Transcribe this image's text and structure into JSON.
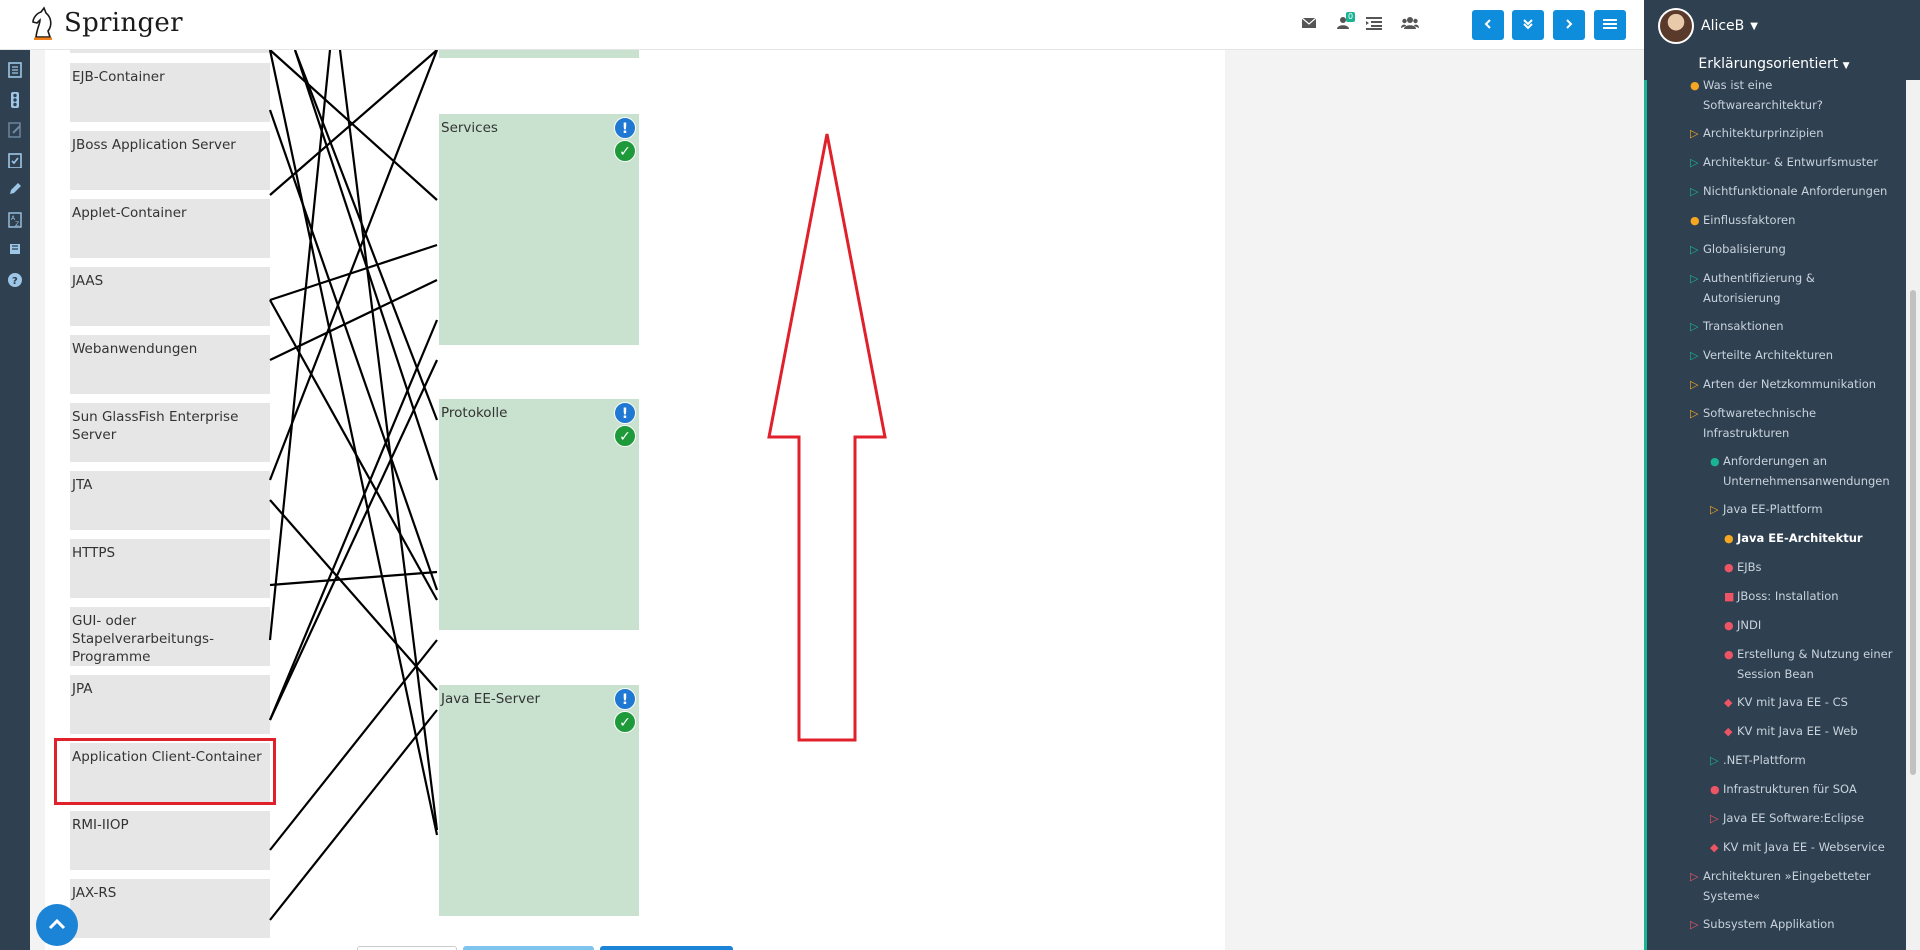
{
  "app": {
    "brand": "Springer",
    "username": "AliceB",
    "mode_label": "Erklärungsorientiert",
    "notification_count": "0"
  },
  "icons": {
    "top": [
      "envelope-icon",
      "users-notification-icon",
      "indent-list-icon",
      "group-icon"
    ],
    "nav": [
      "chevron-left-icon",
      "double-chevron-down-icon",
      "chevron-right-icon",
      "hamburger-menu-icon"
    ],
    "left": [
      "document-icon",
      "traffic-light-icon",
      "edit-document-icon",
      "clipboard-check-icon",
      "pencil-icon",
      "a-z-icon",
      "book-icon",
      "question-icon"
    ]
  },
  "colors": {
    "accent_blue": "#0d8ddb",
    "sidebar_dark": "#2f4050",
    "teal": "#1ab394",
    "target_green": "#c9e2cf",
    "highlight_red": "#e0202a"
  },
  "exercise": {
    "source_items": [
      "EJB-Container",
      "JBoss Application Server",
      "Applet-Container",
      "JAAS",
      "Webanwendungen",
      "Sun GlassFish Enterprise Server",
      "JTA",
      "HTTPS",
      "GUI- oder Stapelverarbeitungs-Programme",
      "JPA",
      "Application Client-Container",
      "RMI-IIOP",
      "JAX-RS"
    ],
    "target_items": [
      "Services",
      "Protokolle",
      "Java EE-Server"
    ]
  },
  "sidebar": {
    "items": [
      {
        "marker": "dot-orange",
        "label": "Was ist eine Softwarearchitektur?"
      },
      {
        "marker": "tri-orange",
        "label": "Architekturprinzipien"
      },
      {
        "marker": "tri-teal",
        "label": "Architektur- & Entwurfsmuster"
      },
      {
        "marker": "tri-teal",
        "label": "Nichtfunktionale Anforderungen"
      },
      {
        "marker": "dot-orange",
        "label": "Einflussfaktoren"
      },
      {
        "marker": "tri-teal",
        "label": "Globalisierung"
      },
      {
        "marker": "tri-teal",
        "label": "Authentifizierung & Autorisierung"
      },
      {
        "marker": "tri-teal",
        "label": "Transaktionen"
      },
      {
        "marker": "tri-teal",
        "label": "Verteilte Architekturen"
      },
      {
        "marker": "tri-orange",
        "label": "Arten der Netzkommunikation"
      },
      {
        "marker": "tri-orange",
        "label": "Softwaretechnische Infrastrukturen"
      },
      {
        "marker": "dot-teal",
        "label": "Anforderungen an Unternehmensanwendungen"
      },
      {
        "marker": "tri-orange",
        "label": "Java EE-Plattform"
      },
      {
        "marker": "dot-orange",
        "label": "Java EE-Architektur"
      },
      {
        "marker": "dot-red",
        "label": "EJBs"
      },
      {
        "marker": "square-red",
        "label": "JBoss: Installation"
      },
      {
        "marker": "dot-red",
        "label": "JNDI"
      },
      {
        "marker": "dot-red",
        "label": "Erstellung & Nutzung einer Session Bean"
      },
      {
        "marker": "diamond-red",
        "label": "KV mit Java EE - CS"
      },
      {
        "marker": "diamond-red",
        "label": "KV mit Java EE - Web"
      },
      {
        "marker": "tri-teal",
        "label": ".NET-Plattform"
      },
      {
        "marker": "dot-red",
        "label": "Infrastrukturen für SOA"
      },
      {
        "marker": "tri-red",
        "label": "Java EE Software:Eclipse"
      },
      {
        "marker": "diamond-red",
        "label": "KV mit Java EE - Webservice"
      },
      {
        "marker": "tri-red",
        "label": "Architekturen »Eingebetteter Systeme«"
      },
      {
        "marker": "tri-red",
        "label": "Subsystem Applikation"
      }
    ]
  }
}
